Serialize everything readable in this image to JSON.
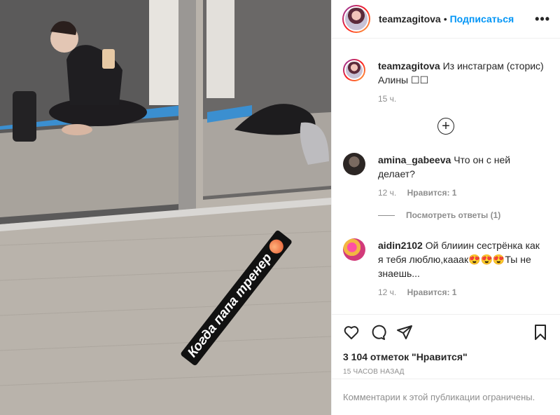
{
  "post": {
    "author": "teamzagitova",
    "follow_label": "Подписаться",
    "separator": "•",
    "more_label": "•••",
    "sticker_text": "Когда папа тренер",
    "caption_user": "teamzagitova",
    "caption_text": "Из инстаграм (сторис) Алины",
    "caption_emoji": "☐☐",
    "caption_time": "15 ч.",
    "likes": "3 104 отметок \"Нравится\"",
    "timestamp": "15 ЧАСОВ НАЗАД",
    "comments_closed": "Комментарии к этой публикации ограничены."
  },
  "comments": [
    {
      "user": "amina_gabeeva",
      "text": "Что он с ней делает?",
      "time": "12 ч.",
      "likes": "Нравится: 1",
      "view_replies": "Посмотреть ответы (1)"
    },
    {
      "user": "aidin2102",
      "text": "Ой блииин сестрёнка как я тебя люблю,кааак😍😍😍Ты не знаешь...",
      "time": "12 ч.",
      "likes": "Нравится: 1"
    }
  ],
  "icons": [
    "heart-icon",
    "comment-icon",
    "share-icon",
    "bookmark-icon",
    "add-comment-icon"
  ],
  "colors": {
    "link": "#0095f6",
    "muted": "#8e8e8e",
    "text": "#262626"
  }
}
